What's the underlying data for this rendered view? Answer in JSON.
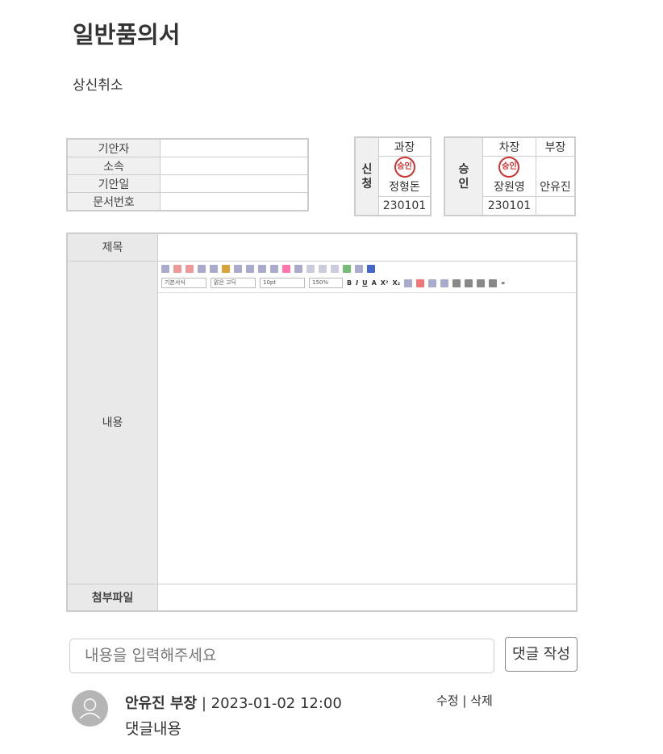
{
  "page": {
    "title": "일반품의서",
    "cancel_link": "상신취소"
  },
  "info_table": {
    "rows": [
      {
        "label": "기안자",
        "value": ""
      },
      {
        "label": "소속",
        "value": ""
      },
      {
        "label": "기안일",
        "value": ""
      },
      {
        "label": "문서번호",
        "value": ""
      }
    ]
  },
  "apply_box": {
    "side_label": "신\n청",
    "columns": [
      {
        "title": "과장",
        "stamp": "승인",
        "name": "정형돈",
        "date": "230101"
      }
    ]
  },
  "approve_box": {
    "side_label": "승\n인",
    "columns": [
      {
        "title": "차장",
        "stamp": "승인",
        "name": "장원영",
        "date": "230101"
      },
      {
        "title": "부장",
        "stamp": "",
        "name": "안유진",
        "date": ""
      }
    ]
  },
  "document": {
    "subject_label": "제목",
    "subject_value": "",
    "content_label": "내용",
    "attachment_label": "첨부파일",
    "editor": {
      "style_select": "기본서식",
      "font_select": "맑은 고딕",
      "size_select": "10pt",
      "lineheight_select": "150%"
    }
  },
  "comment_form": {
    "placeholder": "내용을 입력해주세요",
    "submit_label": "댓글 작성"
  },
  "comments": [
    {
      "author": "안유진 부장",
      "separator": "|",
      "datetime": "2023-01-02 12:00",
      "edit": "수정",
      "delete": "삭제",
      "body": "댓글내용"
    }
  ]
}
